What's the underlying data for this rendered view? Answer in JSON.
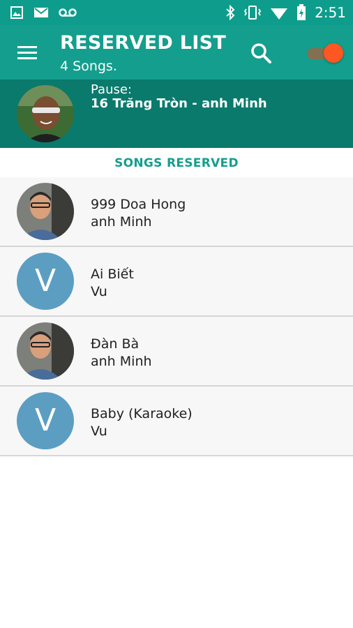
{
  "status_bar": {
    "time": "2:51",
    "left_icons": [
      "image-icon",
      "mail-icon",
      "voicemail-icon"
    ],
    "right_icons": [
      "bluetooth-icon",
      "vibrate-icon",
      "wifi-icon",
      "battery-icon"
    ]
  },
  "app_bar": {
    "title": "RESERVED LIST",
    "subtitle": "4 Songs.",
    "menu_icon": "menu-icon",
    "search_icon": "search-icon",
    "toggle_on": true
  },
  "now_playing": {
    "status": "Pause:",
    "song": "16 Trăng Tròn - anh Minh"
  },
  "section": {
    "header": "SONGS RESERVED"
  },
  "songs": [
    {
      "title": "999 Doa Hong",
      "artist": "anh Minh",
      "avatar": "photo"
    },
    {
      "title": "Ai Biết",
      "artist": "Vu",
      "avatar": "letter",
      "letter": "V"
    },
    {
      "title": "Đàn Bà",
      "artist": "anh Minh",
      "avatar": "photo"
    },
    {
      "title": "Baby (Karaoke)",
      "artist": "Vu",
      "avatar": "letter",
      "letter": "V"
    }
  ],
  "colors": {
    "primary": "#149e8d",
    "primary_dark": "#0a7a6c",
    "accent": "#ff5722",
    "letter_avatar": "#5b9ec2"
  }
}
